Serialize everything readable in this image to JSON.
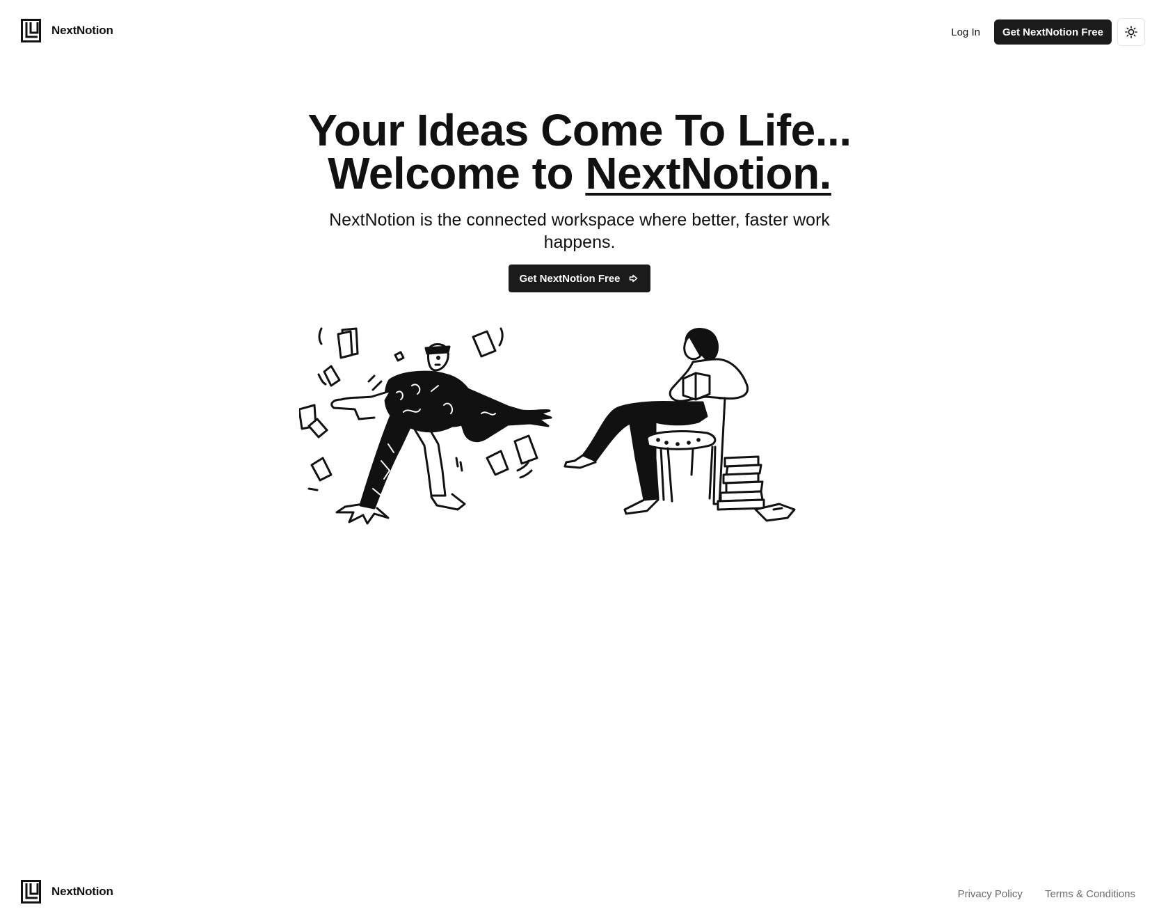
{
  "header": {
    "brand_name": "NextNotion",
    "login_label": "Log In",
    "cta_label": "Get NextNotion Free",
    "theme_icon": "sun-icon"
  },
  "hero": {
    "title_line1": "Your Ideas Come To Life...",
    "title_line2_prefix": "Welcome to ",
    "title_line2_brand": "NextNotion.",
    "subtitle": "NextNotion is the connected workspace where better, faster work happens.",
    "cta_label": "Get NextNotion Free",
    "cta_icon": "arrow-right-icon"
  },
  "footer": {
    "brand_name": "NextNotion",
    "links": [
      "Privacy Policy",
      "Terms & Conditions"
    ]
  },
  "colors": {
    "text": "#111111",
    "button_bg": "#1b1b1b",
    "button_text": "#ffffff",
    "footer_link": "#6b6b6b",
    "border": "#e4e4e4"
  }
}
